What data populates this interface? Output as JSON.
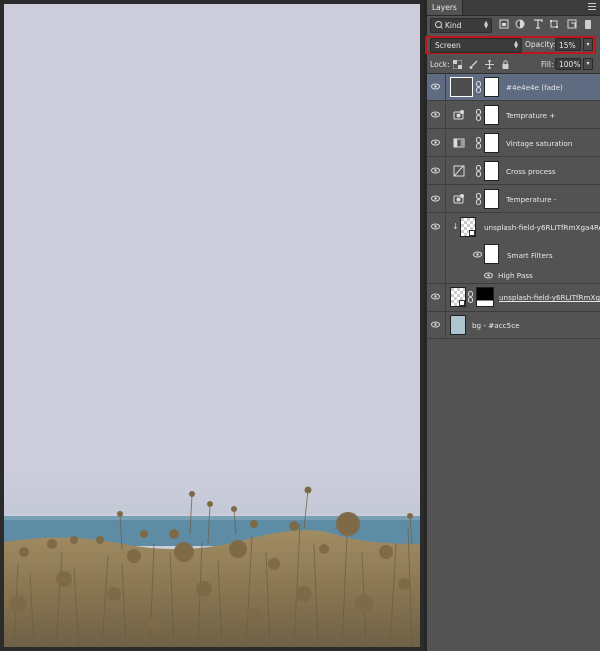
{
  "panel": {
    "tab_label": "Layers",
    "filter": {
      "kind_label": "Kind"
    },
    "blend_mode": "Screen",
    "opacity_label": "Opacity:",
    "opacity_value": "15%",
    "lock_label": "Lock:",
    "fill_label": "Fill:",
    "fill_value": "100%",
    "highlight_color": "#c2141a",
    "selected_row_color": "#5f6b80"
  },
  "layers": [
    {
      "name": "#4e4e4e (fade)",
      "type": "fill"
    },
    {
      "name": "Temprature +",
      "type": "photo-filter"
    },
    {
      "name": "Vintage saturation",
      "type": "hue-saturation"
    },
    {
      "name": "Cross process",
      "type": "curves"
    },
    {
      "name": "Temperature -",
      "type": "photo-filter"
    },
    {
      "name": "unsplash-field-y6RLITfRmXga4Rephk",
      "type": "smart-object"
    },
    {
      "name": "Smart Filters",
      "type": "smart-filter-mask"
    },
    {
      "name": "High Pass",
      "type": "filter"
    },
    {
      "name": "unsplash-field-y6RLITfRmXga4Reph",
      "type": "smart-object-masked"
    },
    {
      "name": "bg - #acc5ce",
      "type": "fill"
    }
  ],
  "canvas": {
    "sky_color": "#ccccdb",
    "sea_color": "#5a8ea8",
    "field_color": "#8c7a57"
  }
}
